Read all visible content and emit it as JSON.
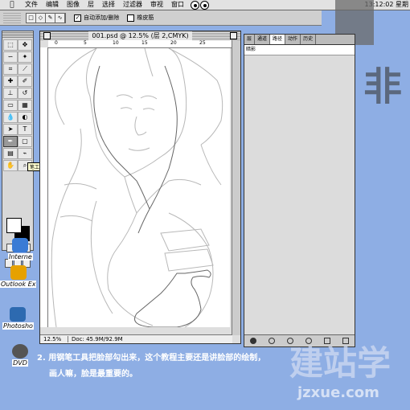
{
  "menubar": {
    "apple": "",
    "items": [
      "文件",
      "编辑",
      "图像",
      "层",
      "选择",
      "过滤器",
      "审视",
      "窗口"
    ],
    "clock": "13:12:02 星期"
  },
  "options_bar": {
    "auto_add_delete_label": "自动添加/删除",
    "auto_add_delete_checked": true,
    "rubber_band_label": "橡皮筋",
    "rubber_band_checked": false
  },
  "toolbox": {
    "tooltip": "笔工具 (P)",
    "tools": [
      "marquee",
      "move",
      "lasso",
      "magic-wand",
      "crop",
      "slice",
      "heal",
      "brush",
      "stamp",
      "history-brush",
      "eraser",
      "gradient",
      "blur",
      "dodge",
      "path-select",
      "type",
      "pen",
      "shape",
      "notes",
      "eyedropper",
      "hand",
      "zoom"
    ]
  },
  "desktop": {
    "icons": [
      {
        "label": "Interne",
        "color": "#3a7bd5"
      },
      {
        "label": "Outlook Ex",
        "color": "#e6a100"
      },
      {
        "label": "Photosho",
        "color": "#2d6ab0"
      },
      {
        "label": "DVD",
        "color": "#555555"
      }
    ]
  },
  "document": {
    "title": "001.psd @ 12.5% (层 2,CMYK)",
    "zoom": "12.5%",
    "doc_size": "Doc: 45.9M/92.9M",
    "ruler_marks": [
      "0",
      "5",
      "10",
      "15",
      "20",
      "25"
    ]
  },
  "panel": {
    "tabs": [
      "层",
      "通道",
      "路径",
      "动作",
      "历史"
    ],
    "active_tab": 2,
    "rows": [
      "暗影"
    ]
  },
  "caption": {
    "line1": "2. 用钢笔工具把脸部勾出来，这个教程主要还是讲脸部的绘制，",
    "line2": "画人嘛，脸是最重要的。"
  },
  "watermark": {
    "big_char": "非",
    "logo_cn": "建站学",
    "logo_url": "jzxue.com"
  },
  "colors": {
    "desktop": "#8eaee4",
    "caption_text": "#ffffff"
  }
}
